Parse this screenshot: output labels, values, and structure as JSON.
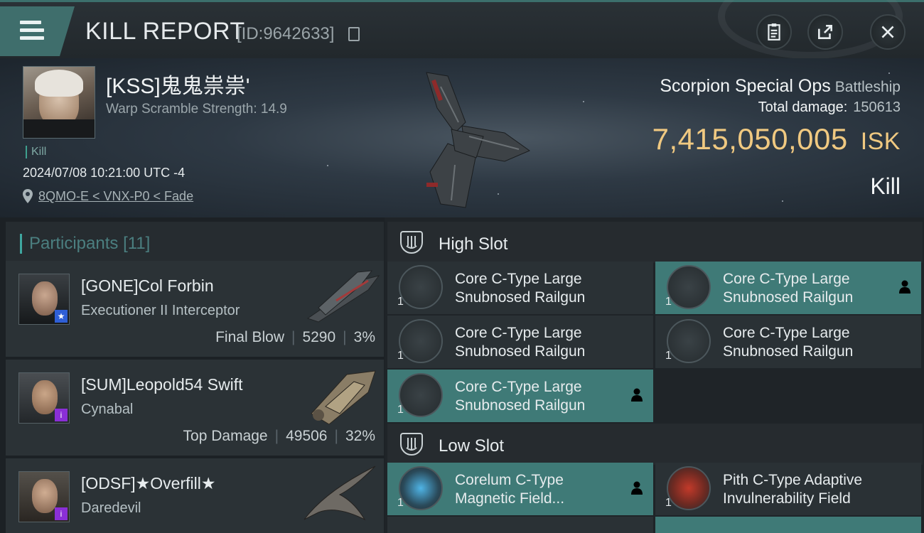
{
  "header": {
    "title": "KILL REPORT",
    "report_id": "[ID:9642633]"
  },
  "victim": {
    "name": "[KSS]鬼鬼祟祟'",
    "warp_scramble": "Warp Scramble Strength: 14.9",
    "tag": "Kill",
    "datetime": "2024/07/08 10:21:00 UTC -4",
    "location": "8QMO-E < VNX-P0 < Fade"
  },
  "ship": {
    "name": "Scorpion Special Ops",
    "class": "Battleship",
    "total_damage_label": "Total damage:",
    "total_damage_value": "150613",
    "isk_value": "7,415,050,005",
    "isk_unit": "ISK",
    "result_label": "Kill"
  },
  "participants": {
    "label": "Participants",
    "count": "[11]",
    "rows": [
      {
        "name": "[GONE]Col Forbin",
        "ship": "Executioner II Interceptor",
        "stat_label": "Final Blow",
        "damage": "5290",
        "percent": "3%",
        "badge_icon": "star-icon",
        "badge_color": "#2f5fd6"
      },
      {
        "name": "[SUM]Leopold54 Swift",
        "ship": "Cynabal",
        "stat_label": "Top Damage",
        "damage": "49506",
        "percent": "32%",
        "badge_icon": "info-icon",
        "badge_color": "#8a2fd6"
      },
      {
        "name": "[ODSF]★Overfill★",
        "ship": "Daredevil",
        "stat_label": "",
        "damage": "",
        "percent": "",
        "badge_icon": "info-icon",
        "badge_color": "#8a2fd6"
      }
    ]
  },
  "fitting": {
    "high_slot_label": "High Slot",
    "low_slot_label": "Low Slot",
    "high_modules": [
      {
        "line1": "Core C-Type Large",
        "line2": "Snubnosed Railgun",
        "qty": "1",
        "state": "destroyed"
      },
      {
        "line1": "Core C-Type Large",
        "line2": "Snubnosed Railgun",
        "qty": "1",
        "state": "dropped"
      },
      {
        "line1": "Core C-Type Large",
        "line2": "Snubnosed Railgun",
        "qty": "1",
        "state": "destroyed"
      },
      {
        "line1": "Core C-Type Large",
        "line2": "Snubnosed Railgun",
        "qty": "1",
        "state": "destroyed"
      },
      {
        "line1": "Core C-Type Large",
        "line2": "Snubnosed Railgun",
        "qty": "1",
        "state": "dropped"
      }
    ],
    "low_modules": [
      {
        "line1": "Corelum C-Type",
        "line2": "Magnetic Field...",
        "qty": "1",
        "state": "dropped"
      },
      {
        "line1": "Pith C-Type Adaptive",
        "line2": "Invulnerability Field",
        "qty": "1",
        "state": "destroyed"
      }
    ]
  },
  "colors": {
    "accent_teal": "#3f7a77",
    "isk_gold": "#f0c981"
  }
}
